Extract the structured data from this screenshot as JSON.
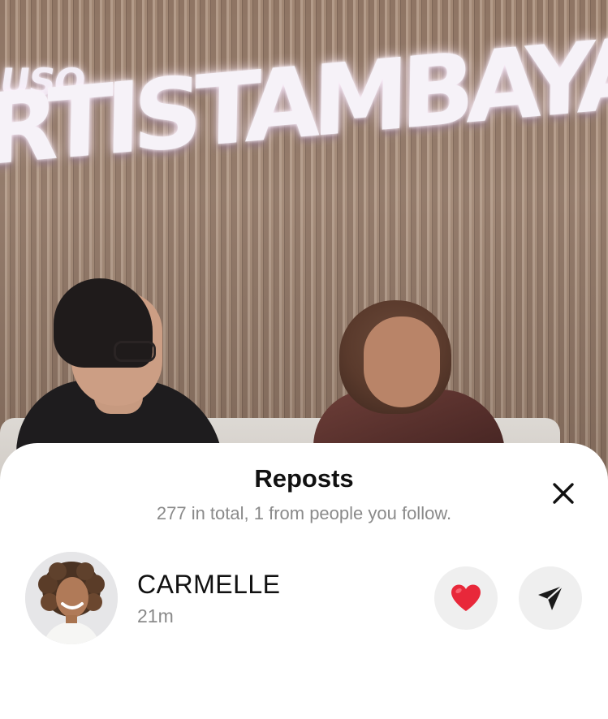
{
  "background": {
    "sign_small_text": "USO",
    "sign_big_text": "RTISTAMBAYA"
  },
  "sheet": {
    "title": "Reposts",
    "subtitle": "277 in total, 1 from people you follow.",
    "close_icon": "close-icon"
  },
  "reposts": [
    {
      "username": "CARMELLE",
      "time": "21m",
      "like_icon": "heart-icon",
      "like_color": "#e8283a",
      "share_icon": "send-icon"
    }
  ]
}
